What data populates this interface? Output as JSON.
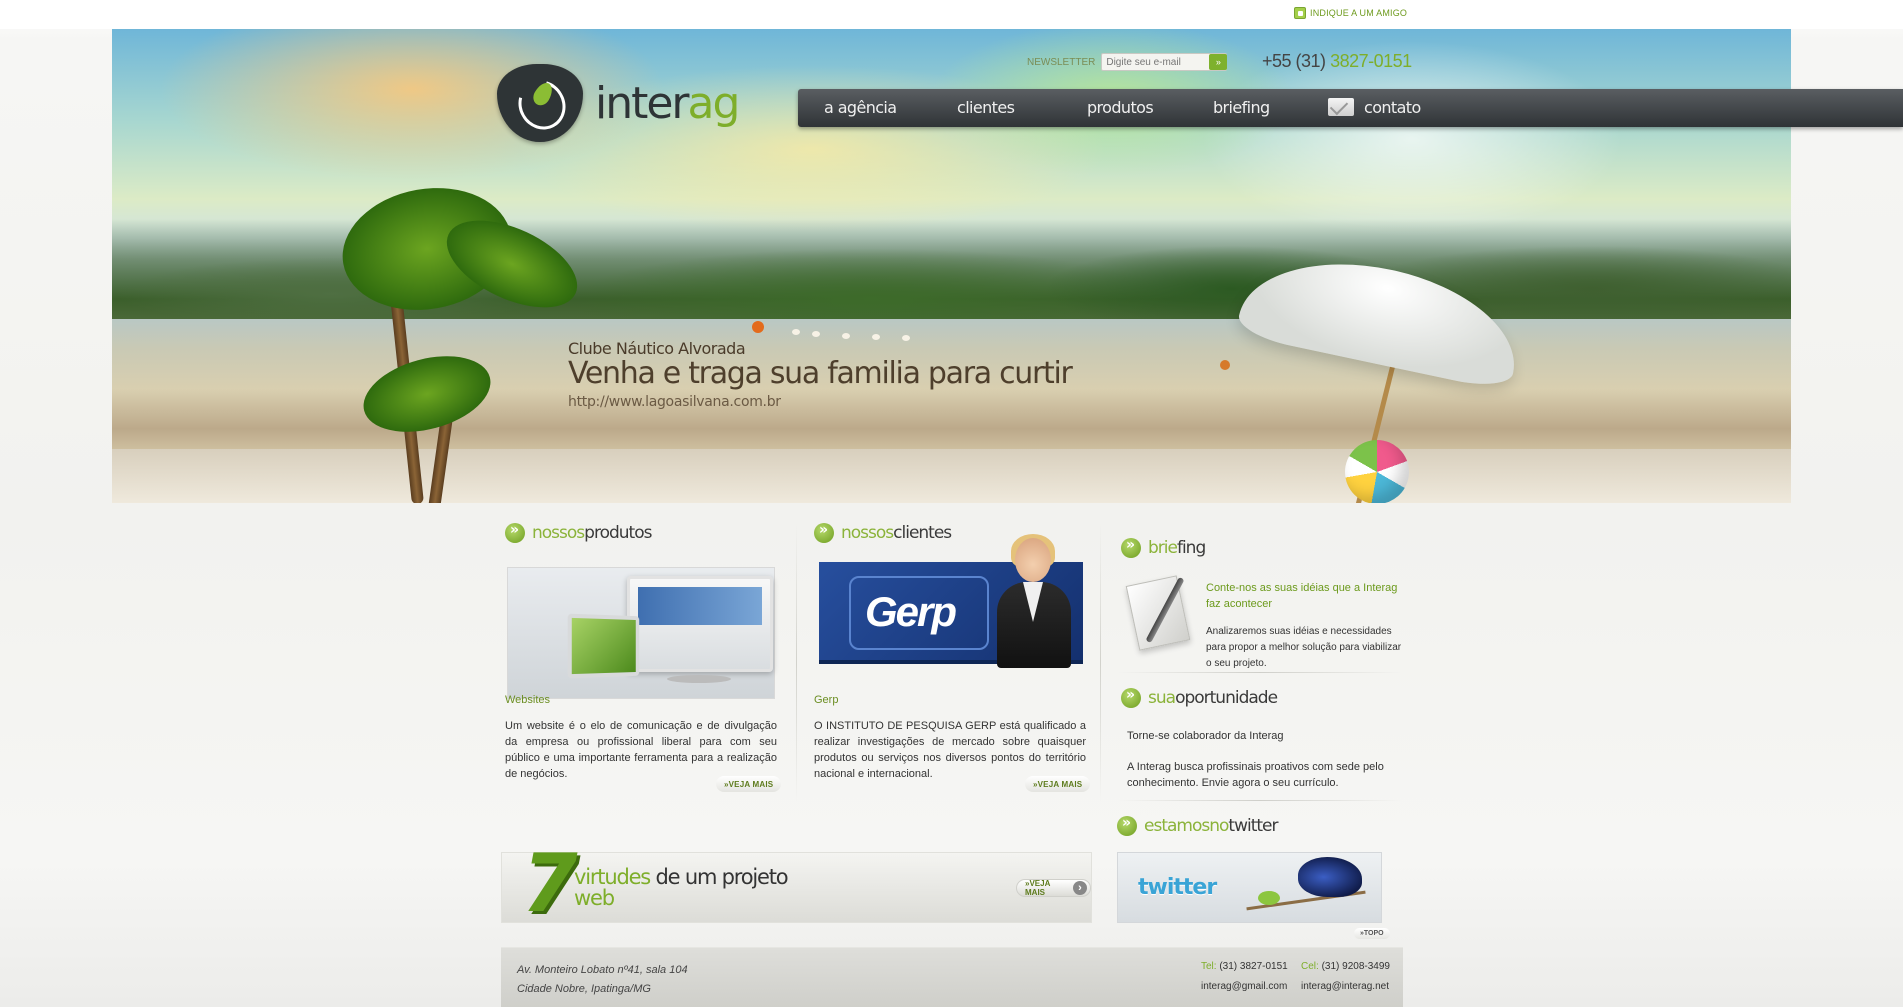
{
  "top": {
    "indique": "INDIQUE A UM AMIGO"
  },
  "header": {
    "logo_part1": "inter",
    "logo_part2": "ag",
    "newsletter_label": "NEWSLETTER",
    "newsletter_placeholder": "Digite seu e-mail",
    "newsletter_button": "»",
    "phone_prefix": "+55 (31)",
    "phone_number": "3827-0151"
  },
  "nav": {
    "items": [
      {
        "label": "a agência"
      },
      {
        "label": "clientes"
      },
      {
        "label": "produtos"
      },
      {
        "label": "briefing"
      },
      {
        "label": "contato"
      }
    ]
  },
  "hero": {
    "subtitle": "Clube Náutico Alvorada",
    "headline": "Venha e traga sua familia para curtir",
    "url": "http://www.lagoasilvana.com.br"
  },
  "produtos": {
    "title_a": "nossos",
    "title_b": "produtos",
    "item_title": "Websites",
    "description": "Um website é o elo de comunicação e de divulgação da empresa ou profissional liberal para com seu público e uma importante ferramenta para a realização de negócios.",
    "more": "»VEJA MAIS"
  },
  "clientes": {
    "title_a": "nossos",
    "title_b": "clientes",
    "logo_text": "Gerp",
    "item_title": "Gerp",
    "description": "O INSTITUTO DE PESQUISA GERP está qualificado a realizar investigações de mercado sobre quaisquer produtos ou serviços nos diversos pontos do território nacional e internacional.",
    "more": "»VEJA MAIS"
  },
  "briefing": {
    "title_a": "brie",
    "title_b": "fing",
    "highlight": "Conte-nos as suas idéias que a Interag faz acontecer",
    "text": "Analizaremos suas idéias e necessidades para propor a melhor solução para viabilizar o seu projeto."
  },
  "oportunidade": {
    "title_a": "sua",
    "title_b": "oportunidade",
    "line1": "Torne-se colaborador da Interag",
    "line2": "A Interag busca profissinais proativos com sede pelo conhecimento. Envie agora o seu currículo."
  },
  "twitter": {
    "title_a": "estamosno",
    "title_b": "twitter",
    "logo_text": "twitter",
    "topo": "»TOPO"
  },
  "virtudes": {
    "number": "7",
    "word1": "virtudes",
    "word2": " de um projeto",
    "word3": "web",
    "more": "»VEJA MAIS"
  },
  "footer": {
    "address1": "Av. Monteiro Lobato nº41, sala 104",
    "address2": "Cidade Nobre, Ipatinga/MG",
    "tel_label": "Tel:",
    "tel": "(31) 3827-0151",
    "cel_label": "Cel:",
    "cel": "(31) 9208-3499",
    "email1": "interag@gmail.com",
    "email2": "interag@interag.net"
  },
  "colors": {
    "brand_green": "#7eae2a",
    "nav_dark": "#2f3336",
    "text": "#333333"
  }
}
